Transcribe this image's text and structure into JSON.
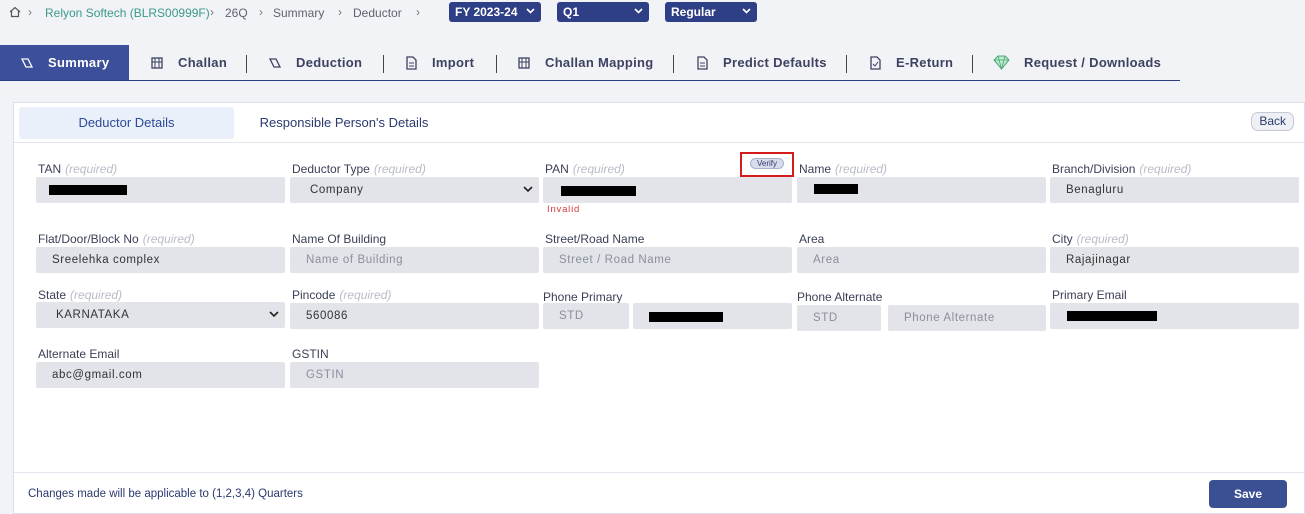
{
  "breadcrumb": {
    "company": "Relyon Softech (BLRS00999F)",
    "form": "26Q",
    "summary": "Summary",
    "deductor": "Deductor"
  },
  "selectors": {
    "fy": "FY 2023-24",
    "quarter": "Q1",
    "type": "Regular"
  },
  "tabs": [
    "Summary",
    "Challan",
    "Deduction",
    "Import",
    "Challan Mapping",
    "Predict Defaults",
    "E-Return",
    "Request / Downloads"
  ],
  "subtabs": {
    "deductor_details": "Deductor Details",
    "responsible_person": "Responsible Person's Details",
    "back": "Back"
  },
  "required_text": "(required)",
  "fields": {
    "tan_label": "TAN",
    "deductor_type_label": "Deductor Type",
    "deductor_type_value": "Company",
    "pan_label": "PAN",
    "pan_invalid": "Invalid",
    "verify": "Verify",
    "name_label": "Name",
    "branch_label": "Branch/Division",
    "branch_value": "Benagluru",
    "flat_label": "Flat/Door/Block No",
    "flat_value": "Sreelehka complex",
    "building_label": "Name Of Building",
    "building_placeholder": "Name of Building",
    "street_label": "Street/Road Name",
    "street_placeholder": "Street / Road Name",
    "area_label": "Area",
    "area_placeholder": "Area",
    "city_label": "City",
    "city_value": "Rajajinagar",
    "state_label": "State",
    "state_value": "KARNATAKA",
    "pincode_label": "Pincode",
    "pincode_value": "560086",
    "phone_primary_label": "Phone Primary",
    "phone_primary_std": "STD",
    "phone_alt_label": "Phone Alternate",
    "phone_alt_std": "STD",
    "phone_alt_placeholder": "Phone Alternate",
    "primary_email_label": "Primary Email",
    "alt_email_label": "Alternate Email",
    "alt_email_value": "abc@gmail.com",
    "gstin_label": "GSTIN",
    "gstin_placeholder": "GSTIN"
  },
  "footer": {
    "note": "Changes made will be applicable to (1,2,3,4) Quarters",
    "save": "Save"
  },
  "colors": {
    "primary": "#2f3f86",
    "active_tab": "#3c4f9a",
    "link": "#3a9a8a",
    "invalid": "#d23b3b",
    "highlight_box": "#d41c1c"
  }
}
